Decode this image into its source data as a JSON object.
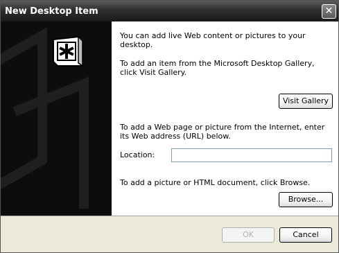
{
  "window": {
    "title": "New Desktop Item"
  },
  "intro": "You can add live Web content or pictures to your desktop.",
  "gallery": {
    "text": "To add an item from the Microsoft Desktop Gallery, click Visit Gallery.",
    "button": "Visit Gallery"
  },
  "web": {
    "text": "To add a Web page or picture from the Internet, enter its Web address (URL) below.",
    "location_label": "Location:",
    "location_value": ""
  },
  "browse": {
    "text": "To add a picture or HTML document, click Browse.",
    "button": "Browse..."
  },
  "footer": {
    "ok": "OK",
    "cancel": "Cancel"
  },
  "icons": {
    "close": "close-icon",
    "desktop_item": "desktop-item-icon"
  }
}
